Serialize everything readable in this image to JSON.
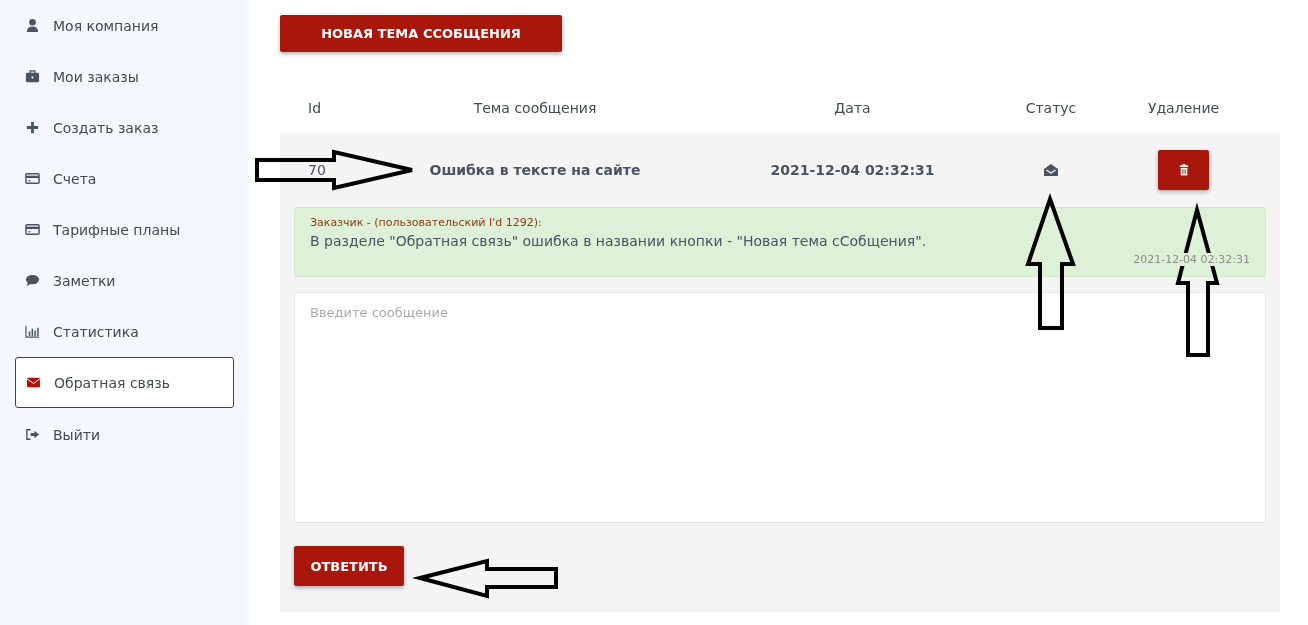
{
  "sidebar": {
    "items": [
      {
        "label": "Моя компания",
        "kind": "user",
        "selected": false
      },
      {
        "label": "Мои заказы",
        "kind": "briefcase",
        "selected": false
      },
      {
        "label": "Создать заказ",
        "kind": "plus",
        "selected": false
      },
      {
        "label": "Счета",
        "kind": "card",
        "selected": false
      },
      {
        "label": "Тарифные планы",
        "kind": "card",
        "selected": false
      },
      {
        "label": "Заметки",
        "kind": "comment",
        "selected": false
      },
      {
        "label": "Статистика",
        "kind": "chart",
        "selected": false
      },
      {
        "label": "Обратная связь",
        "kind": "envelope",
        "selected": true
      },
      {
        "label": "Выйти",
        "kind": "logout",
        "selected": false
      }
    ]
  },
  "new_topic_button": "НОВАЯ ТЕМА ССОБЩЕНИЯ",
  "table": {
    "columns": [
      "Id",
      "Тема сообщения",
      "Дата",
      "Статус",
      "Удаление"
    ],
    "rows": [
      {
        "id": "70",
        "subject": "Ошибка в тексте на сайте",
        "date": "2021-12-04 02:32:31",
        "read": true,
        "expanded": true,
        "messages": [
          {
            "author": "Заказчик - (пользовательский I'd 1292):",
            "text": "В разделе \"Обратная связь\" ошибка в названии кнопки - \"Новая тема сСобщения\".",
            "time": "2021-12-04 02:32:31"
          }
        ],
        "reply": {
          "placeholder": "Введите сообщение"
        },
        "reply_button": "ОТВЕТИТЬ"
      }
    ]
  }
}
